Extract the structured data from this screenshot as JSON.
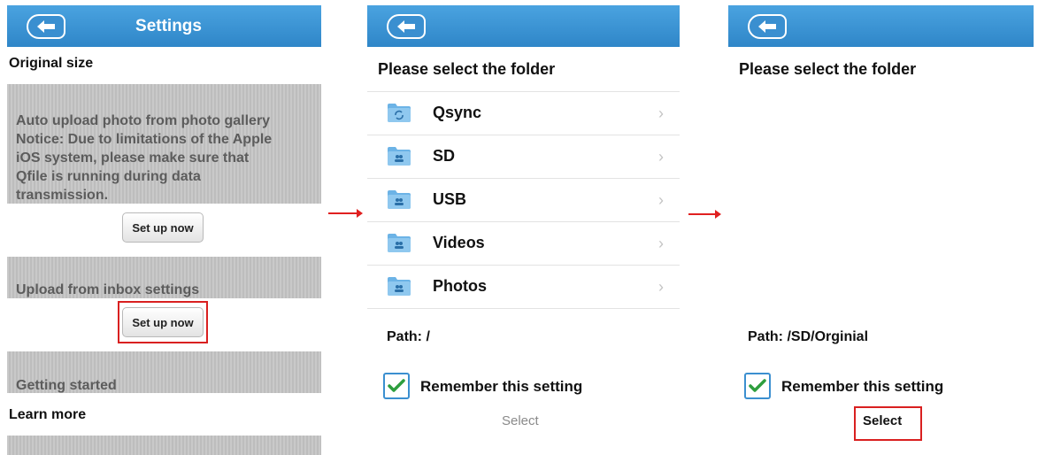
{
  "panel1": {
    "title": "Settings",
    "original_size": "Original size",
    "auto_upload_lines": [
      "Auto upload photo from photo gallery",
      "Notice: Due to limitations of the Apple",
      "iOS system, please make sure that",
      "Qfile is running during data",
      "transmission."
    ],
    "setup_button_1": "Set up now",
    "inbox_heading": "Upload from inbox settings",
    "setup_button_2": "Set up now",
    "getting_started": "Getting started",
    "learn_more": "Learn more"
  },
  "panel2": {
    "heading": "Please select the folder",
    "folders": [
      {
        "label": "Qsync",
        "icon": "sync-folder-icon"
      },
      {
        "label": "SD",
        "icon": "shared-folder-icon"
      },
      {
        "label": "USB",
        "icon": "shared-folder-icon"
      },
      {
        "label": "Videos",
        "icon": "shared-folder-icon"
      },
      {
        "label": "Photos",
        "icon": "shared-folder-icon"
      }
    ],
    "path": "Path: /",
    "remember": "Remember this setting",
    "select": "Select"
  },
  "panel3": {
    "heading": "Please select the folder",
    "path": "Path: /SD/Orginial",
    "remember": "Remember this setting",
    "select": "Select"
  },
  "colors": {
    "topbar": "#3a8fd0",
    "highlight": "#d92020",
    "check": "#2e9e3e"
  }
}
